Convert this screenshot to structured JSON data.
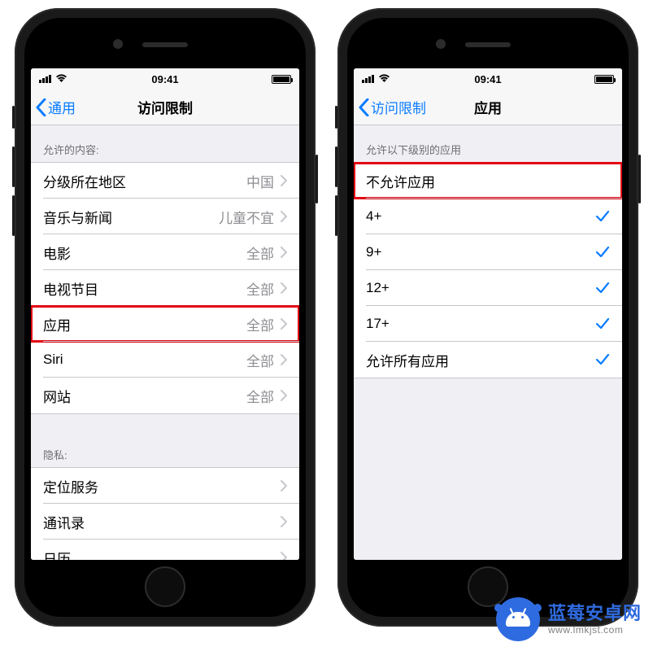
{
  "watermark": {
    "title": "蓝莓安卓网",
    "url": "www.lmkjst.com"
  },
  "phones": {
    "left": {
      "status": {
        "time": "09:41"
      },
      "nav": {
        "back": "通用",
        "title": "访问限制"
      },
      "section1_header": "允许的内容:",
      "section1": [
        {
          "label": "分级所在地区",
          "value": "中国",
          "highlight": false
        },
        {
          "label": "音乐与新闻",
          "value": "儿童不宜",
          "highlight": false
        },
        {
          "label": "电影",
          "value": "全部",
          "highlight": false
        },
        {
          "label": "电视节目",
          "value": "全部",
          "highlight": false
        },
        {
          "label": "应用",
          "value": "全部",
          "highlight": true
        },
        {
          "label": "Siri",
          "value": "全部",
          "highlight": false
        },
        {
          "label": "网站",
          "value": "全部",
          "highlight": false
        }
      ],
      "section2_header": "隐私:",
      "section2": [
        {
          "label": "定位服务"
        },
        {
          "label": "通讯录"
        },
        {
          "label": "日历"
        }
      ]
    },
    "right": {
      "status": {
        "time": "09:41"
      },
      "nav": {
        "back": "访问限制",
        "title": "应用"
      },
      "section_header": "允许以下级别的应用",
      "items": [
        {
          "label": "不允许应用",
          "checked": false,
          "highlight": true
        },
        {
          "label": "4+",
          "checked": true,
          "highlight": false
        },
        {
          "label": "9+",
          "checked": true,
          "highlight": false
        },
        {
          "label": "12+",
          "checked": true,
          "highlight": false
        },
        {
          "label": "17+",
          "checked": true,
          "highlight": false
        },
        {
          "label": "允许所有应用",
          "checked": true,
          "highlight": false
        }
      ]
    }
  }
}
